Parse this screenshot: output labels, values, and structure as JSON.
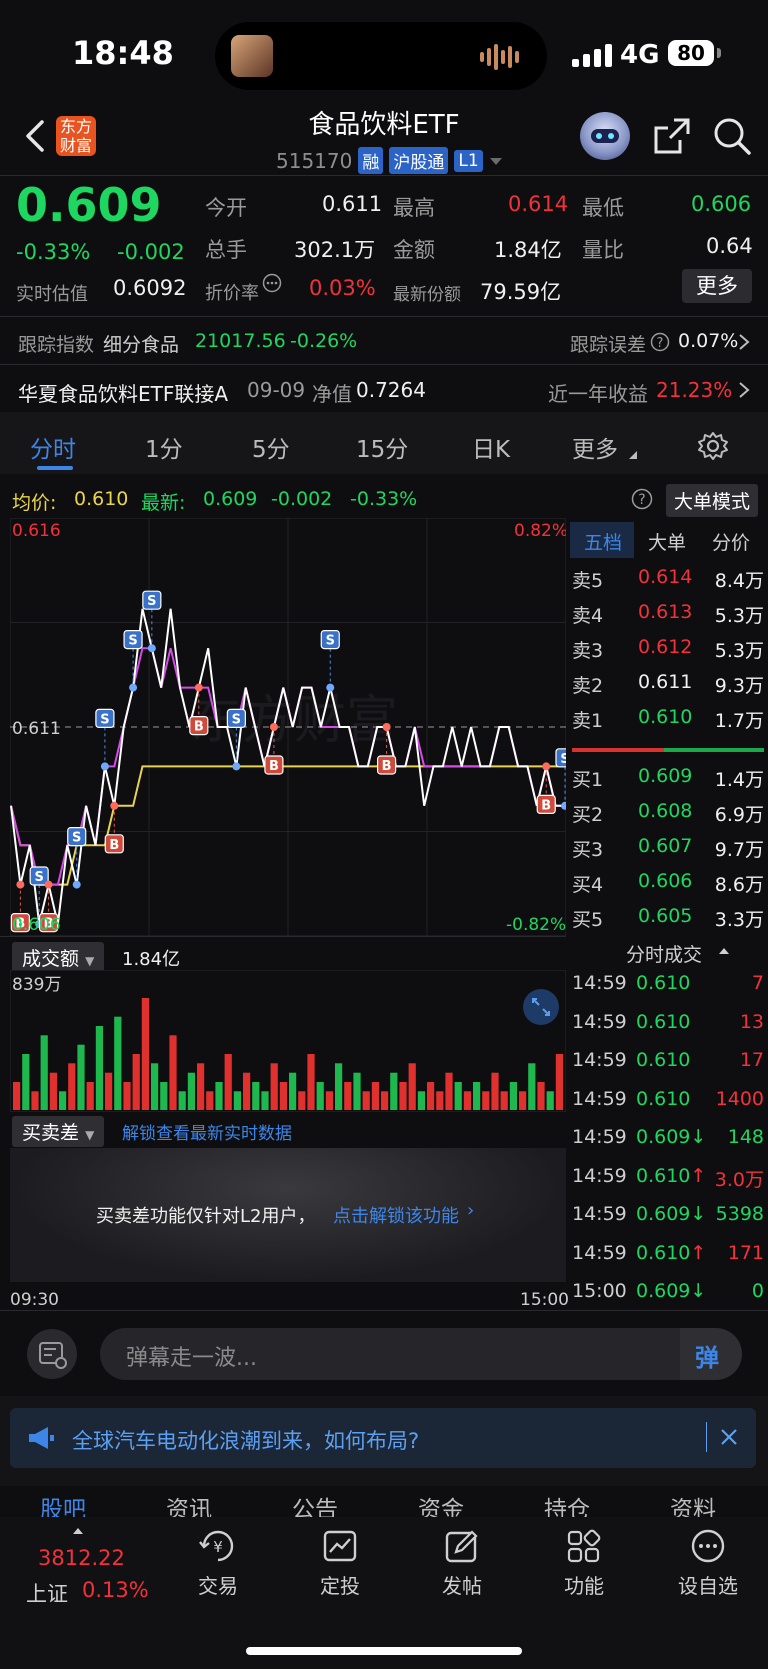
{
  "status_bar": {
    "time": "18:48",
    "network": "4G",
    "battery": "80"
  },
  "header": {
    "app_logo": "东方\n财富",
    "title": "食品饮料ETF",
    "code": "515170",
    "tags": [
      "融",
      "沪股通",
      "L1"
    ]
  },
  "quote": {
    "price": "0.609",
    "change_pct": "-0.33%",
    "change": "-0.002",
    "open_label": "今开",
    "open": "0.611",
    "high_label": "最高",
    "high": "0.614",
    "low_label": "最低",
    "low": "0.606",
    "volume_label": "总手",
    "volume": "302.1万",
    "amount_label": "金额",
    "amount": "1.84亿",
    "ratio_label": "量比",
    "ratio": "0.64",
    "iopv_label": "实时估值",
    "iopv": "0.6092",
    "discount_label": "折价率",
    "discount": "0.03%",
    "shares_label": "最新份额",
    "shares": "79.59亿",
    "more_button": "更多"
  },
  "tracking": {
    "label": "跟踪指数",
    "index_name": "细分食品",
    "index_value": "21017.56",
    "index_change": "-0.26%",
    "error_label": "跟踪误差",
    "error_value": "0.07%"
  },
  "fund_link": {
    "name": "华夏食品饮料ETF联接A",
    "date": "09-09",
    "nav_label": "净值",
    "nav": "0.7264",
    "return_label": "近一年收益",
    "return_value": "21.23%"
  },
  "tabs": [
    "分时",
    "1分",
    "5分",
    "15分",
    "日K",
    "更多"
  ],
  "chart_header": {
    "avg_label": "均价:",
    "avg": "0.610",
    "latest_label": "最新:",
    "latest": "0.609",
    "change": "-0.002",
    "change_pct": "-0.33%",
    "big_order_button": "大单模式"
  },
  "chart_labels": {
    "top_price": "0.616",
    "top_pct": "0.82%",
    "mid_price": "0.611",
    "bottom_price": "0.606",
    "bottom_pct": "-0.82%",
    "watermark": "东方财富"
  },
  "chart_data": {
    "type": "line",
    "price_range": [
      0.606,
      0.616
    ],
    "reference": 0.611,
    "series": [
      {
        "color": "#ffffff",
        "values": [
          0.609,
          0.607,
          0.608,
          0.606,
          0.607,
          0.606,
          0.608,
          0.607,
          0.609,
          0.608,
          0.61,
          0.609,
          0.611,
          0.612,
          0.614,
          0.613,
          0.612,
          0.614,
          0.612,
          0.611,
          0.612,
          0.613,
          0.611,
          0.611,
          0.61,
          0.612,
          0.611,
          0.61,
          0.611,
          0.612,
          0.611,
          0.612,
          0.612,
          0.611,
          0.612,
          0.611,
          0.611,
          0.61,
          0.61,
          0.611,
          0.611,
          0.61,
          0.61,
          0.611,
          0.609,
          0.61,
          0.61,
          0.611,
          0.61,
          0.611,
          0.61,
          0.61,
          0.611,
          0.611,
          0.61,
          0.61,
          0.609,
          0.61,
          0.609,
          0.609
        ]
      },
      {
        "color": "#d64be8",
        "values": [
          0.609,
          0.608,
          0.608,
          0.607,
          0.607,
          0.607,
          0.608,
          0.608,
          0.609,
          0.608,
          0.61,
          0.61,
          0.611,
          0.612,
          0.613,
          0.613,
          0.612,
          0.613,
          0.612,
          0.612,
          0.612,
          0.612,
          0.611,
          0.611,
          0.611,
          0.612,
          0.611,
          0.61,
          0.611,
          0.612,
          0.611,
          0.612,
          0.612,
          0.611,
          0.611,
          0.611,
          0.611,
          0.61,
          0.61,
          0.611,
          0.611,
          0.61,
          0.61,
          0.611,
          0.61,
          0.61,
          0.61,
          0.61,
          0.61,
          0.61,
          0.61,
          0.61,
          0.611,
          0.611,
          0.61,
          0.61,
          0.609,
          0.61,
          0.609,
          0.609
        ]
      },
      {
        "color": "#e8d44d",
        "values": [
          0.609,
          0.608,
          0.608,
          0.607,
          0.607,
          0.607,
          0.607,
          0.608,
          0.608,
          0.608,
          0.608,
          0.609,
          0.609,
          0.609,
          0.61,
          0.61,
          0.61,
          0.61,
          0.61,
          0.61,
          0.61,
          0.61,
          0.61,
          0.61,
          0.61,
          0.61,
          0.61,
          0.61,
          0.61,
          0.61,
          0.61,
          0.61,
          0.61,
          0.61,
          0.61,
          0.61,
          0.61,
          0.61,
          0.61,
          0.61,
          0.61,
          0.61,
          0.61,
          0.61,
          0.61,
          0.61,
          0.61,
          0.61,
          0.61,
          0.61,
          0.61,
          0.61,
          0.61,
          0.61,
          0.61,
          0.61,
          0.61,
          0.61,
          0.61,
          0.61
        ]
      }
    ],
    "volume_max_label": "839万",
    "volume": [
      3,
      6,
      2,
      8,
      4,
      2,
      5,
      7,
      3,
      9,
      4,
      10,
      3,
      6,
      12,
      5,
      3,
      8,
      2,
      4,
      5,
      2,
      3,
      6,
      2,
      4,
      3,
      2,
      5,
      3,
      4,
      2,
      6,
      3,
      2,
      5,
      3,
      4,
      2,
      3,
      2,
      4,
      3,
      5,
      2,
      3,
      2,
      4,
      3,
      2,
      3,
      2,
      4,
      2,
      3,
      2,
      5,
      3,
      2,
      6
    ]
  },
  "markers": {
    "sell": "S",
    "buy": "B"
  },
  "order_book": {
    "tabs": [
      "五档",
      "大单",
      "分价"
    ],
    "asks": [
      {
        "label": "卖5",
        "price": "0.614",
        "vol": "8.4万",
        "color": "#f2323a"
      },
      {
        "label": "卖4",
        "price": "0.613",
        "vol": "5.3万",
        "color": "#f2323a"
      },
      {
        "label": "卖3",
        "price": "0.612",
        "vol": "5.3万",
        "color": "#f2323a"
      },
      {
        "label": "卖2",
        "price": "0.611",
        "vol": "9.3万",
        "color": "#f0f0f0"
      },
      {
        "label": "卖1",
        "price": "0.610",
        "vol": "1.7万",
        "color": "#1ed760"
      }
    ],
    "bids": [
      {
        "label": "买1",
        "price": "0.609",
        "vol": "1.4万",
        "color": "#1ed760"
      },
      {
        "label": "买2",
        "price": "0.608",
        "vol": "6.9万",
        "color": "#1ed760"
      },
      {
        "label": "买3",
        "price": "0.607",
        "vol": "9.7万",
        "color": "#1ed760"
      },
      {
        "label": "买4",
        "price": "0.606",
        "vol": "8.6万",
        "color": "#1ed760"
      },
      {
        "label": "买5",
        "price": "0.605",
        "vol": "3.3万",
        "color": "#1ed760"
      }
    ]
  },
  "ticks": {
    "header": "分时成交",
    "rows": [
      {
        "time": "14:59",
        "price": "0.610",
        "vol": "7",
        "vcolor": "#f2323a"
      },
      {
        "time": "14:59",
        "price": "0.610",
        "vol": "13",
        "vcolor": "#f2323a"
      },
      {
        "time": "14:59",
        "price": "0.610",
        "vol": "17",
        "vcolor": "#f2323a"
      },
      {
        "time": "14:59",
        "price": "0.610",
        "vol": "1400",
        "vcolor": "#f2323a"
      },
      {
        "time": "14:59",
        "price": "0.609↓",
        "vol": "148",
        "vcolor": "#1ed760"
      },
      {
        "time": "14:59",
        "price": "0.610↑",
        "vol": "3.0万",
        "vcolor": "#f2323a"
      },
      {
        "time": "14:59",
        "price": "0.609↓",
        "vol": "5398",
        "vcolor": "#1ed760"
      },
      {
        "time": "14:59",
        "price": "0.610↑",
        "vol": "171",
        "vcolor": "#f2323a"
      },
      {
        "time": "15:00",
        "price": "0.609↓",
        "vol": "0",
        "vcolor": "#1ed760"
      }
    ]
  },
  "volume_panel": {
    "select": "成交额",
    "value": "1.84亿"
  },
  "spread_panel": {
    "select": "买卖差",
    "unlock_link": "解锁查看最新实时数据",
    "message": "买卖差功能仅针对L2用户，",
    "unlock_action": "点击解锁该功能"
  },
  "time_axis": {
    "start": "09:30",
    "end": "15:00"
  },
  "danmaku": {
    "placeholder": "弹幕走一波...",
    "send_icon": "弹"
  },
  "news_banner": {
    "text": "全球汽车电动化浪潮到来，如何布局?"
  },
  "section_tabs": [
    "股吧",
    "资讯",
    "公告",
    "资金",
    "持仓",
    "资料"
  ],
  "index_ticker": {
    "value": "3812.22",
    "name": "上证",
    "change": "0.13%"
  },
  "bottom_nav": [
    "交易",
    "定投",
    "发帖",
    "功能",
    "设自选"
  ]
}
